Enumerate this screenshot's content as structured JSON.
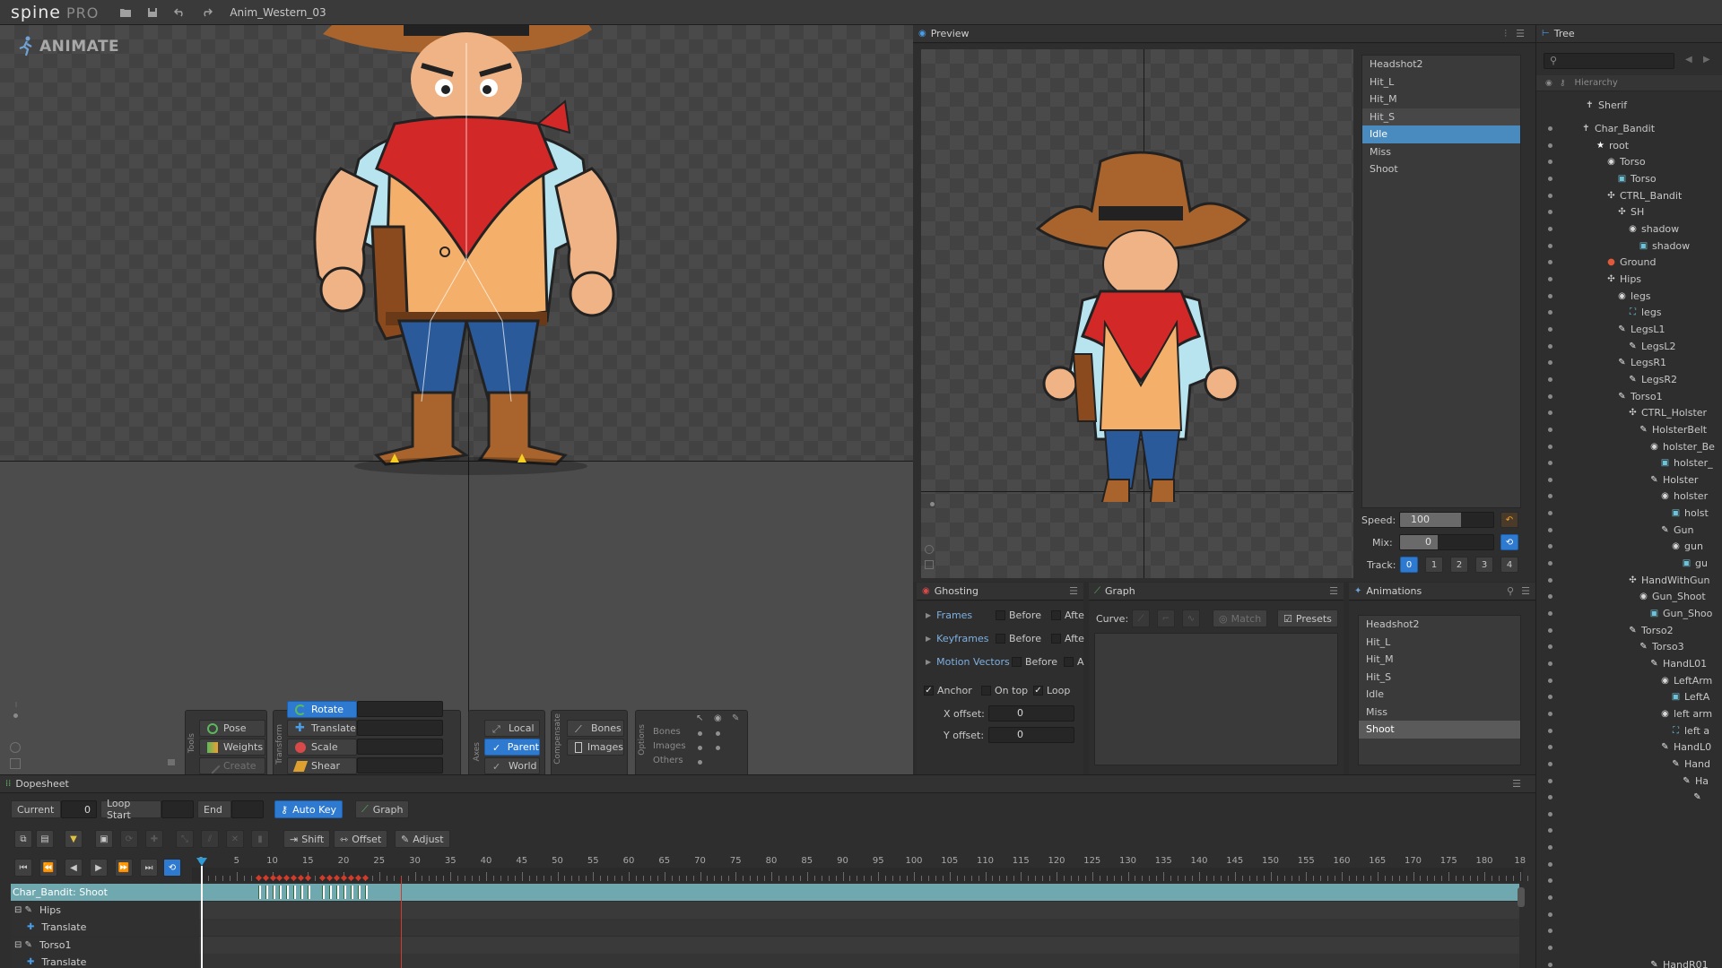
{
  "app": {
    "logo_main": "spine",
    "logo_pro": "PRO",
    "filename": "Anim_Western_03",
    "mode": "ANIMATE"
  },
  "tools": {
    "tools_label": "Tools",
    "transform_label": "Transform",
    "axes_label": "Axes",
    "compensate_label": "Compensate",
    "options_label": "Options",
    "pose": "Pose",
    "weights": "Weights",
    "create": "Create",
    "rotate": "Rotate",
    "translate": "Translate",
    "scale": "Scale",
    "shear": "Shear",
    "local": "Local",
    "parent": "Parent",
    "world": "World",
    "bones": "Bones",
    "images": "Images",
    "opt_bones": "Bones",
    "opt_images": "Images",
    "opt_others": "Others"
  },
  "preview": {
    "title": "Preview",
    "animations": [
      "Headshot2",
      "Hit_L",
      "Hit_M",
      "Hit_S",
      "Idle",
      "Miss",
      "Shoot"
    ],
    "selected": "Idle",
    "speed_label": "Speed:",
    "speed_value": "100",
    "speed_fraction": 0.65,
    "mix_label": "Mix:",
    "mix_value": "0",
    "mix_fraction": 0.4,
    "track_label": "Track:",
    "tracks": [
      "0",
      "1",
      "2",
      "3",
      "4"
    ],
    "active_track": "0"
  },
  "ghosting": {
    "title": "Ghosting",
    "frames": "Frames",
    "keyframes": "Keyframes",
    "motion_vectors": "Motion Vectors",
    "before": "Before",
    "after": "Afte",
    "after_short": "A",
    "anchor": "Anchor",
    "on_top": "On top",
    "loop": "Loop",
    "x_offset_label": "X offset:",
    "x_offset": "0",
    "y_offset_label": "Y offset:",
    "y_offset": "0"
  },
  "graph": {
    "title": "Graph",
    "curve_label": "Curve:",
    "match": "Match",
    "presets": "Presets"
  },
  "animations": {
    "title": "Animations",
    "items": [
      "Headshot2",
      "Hit_L",
      "Hit_M",
      "Hit_S",
      "Idle",
      "Miss",
      "Shoot"
    ],
    "selected": "Shoot"
  },
  "tree": {
    "title": "Tree",
    "hierarchy": "Hierarchy",
    "rows": [
      {
        "label": "Sherif",
        "indent": 0,
        "icon": "skeleton"
      },
      {
        "label": "Char_Bandit",
        "indent": 0,
        "icon": "skeleton"
      },
      {
        "label": "root",
        "indent": 1,
        "icon": "root"
      },
      {
        "label": "Torso",
        "indent": 2,
        "icon": "slot"
      },
      {
        "label": "Torso",
        "indent": 3,
        "icon": "image"
      },
      {
        "label": "CTRL_Bandit",
        "indent": 2,
        "icon": "bone"
      },
      {
        "label": "SH",
        "indent": 3,
        "icon": "bone"
      },
      {
        "label": "shadow",
        "indent": 4,
        "icon": "slot"
      },
      {
        "label": "shadow",
        "indent": 5,
        "icon": "image"
      },
      {
        "label": "Ground",
        "indent": 2,
        "icon": "ground"
      },
      {
        "label": "Hips",
        "indent": 2,
        "icon": "bone"
      },
      {
        "label": "legs",
        "indent": 3,
        "icon": "slot"
      },
      {
        "label": "legs",
        "indent": 4,
        "icon": "mesh"
      },
      {
        "label": "LegsL1",
        "indent": 3,
        "icon": "bone2"
      },
      {
        "label": "LegsL2",
        "indent": 4,
        "icon": "bone2"
      },
      {
        "label": "LegsR1",
        "indent": 3,
        "icon": "bone2"
      },
      {
        "label": "LegsR2",
        "indent": 4,
        "icon": "bone2"
      },
      {
        "label": "Torso1",
        "indent": 3,
        "icon": "bone2"
      },
      {
        "label": "CTRL_Holster",
        "indent": 4,
        "icon": "bone"
      },
      {
        "label": "HolsterBelt",
        "indent": 5,
        "icon": "bone2"
      },
      {
        "label": "holster_Be",
        "indent": 6,
        "icon": "slot"
      },
      {
        "label": "holster_",
        "indent": 7,
        "icon": "image"
      },
      {
        "label": "Holster",
        "indent": 6,
        "icon": "bone2"
      },
      {
        "label": "holster",
        "indent": 7,
        "icon": "slot"
      },
      {
        "label": "holst",
        "indent": 8,
        "icon": "image"
      },
      {
        "label": "Gun",
        "indent": 7,
        "icon": "bone2"
      },
      {
        "label": "gun",
        "indent": 8,
        "icon": "slot"
      },
      {
        "label": "gu",
        "indent": 9,
        "icon": "image"
      },
      {
        "label": "HandWithGun",
        "indent": 4,
        "icon": "bone"
      },
      {
        "label": "Gun_Shoot",
        "indent": 5,
        "icon": "slot"
      },
      {
        "label": "Gun_Shoo",
        "indent": 6,
        "icon": "image"
      },
      {
        "label": "Torso2",
        "indent": 4,
        "icon": "bone2"
      },
      {
        "label": "Torso3",
        "indent": 5,
        "icon": "bone2"
      },
      {
        "label": "HandL01",
        "indent": 6,
        "icon": "bone2"
      },
      {
        "label": "LeftArm",
        "indent": 7,
        "icon": "slot"
      },
      {
        "label": "LeftA",
        "indent": 8,
        "icon": "image"
      },
      {
        "label": "left arm",
        "indent": 7,
        "icon": "slot"
      },
      {
        "label": "left a",
        "indent": 8,
        "icon": "mesh"
      },
      {
        "label": "HandL0",
        "indent": 7,
        "icon": "bone2"
      },
      {
        "label": "Hand",
        "indent": 8,
        "icon": "bone2"
      },
      {
        "label": "Ha",
        "indent": 9,
        "icon": "bone2"
      },
      {
        "label": "",
        "indent": 10,
        "icon": "bone2"
      },
      {
        "label": "",
        "indent": 10,
        "icon": "none"
      },
      {
        "label": "",
        "indent": 10,
        "icon": "none"
      },
      {
        "label": "",
        "indent": 10,
        "icon": "none"
      },
      {
        "label": "",
        "indent": 10,
        "icon": "none"
      },
      {
        "label": "",
        "indent": 10,
        "icon": "none"
      },
      {
        "label": "",
        "indent": 10,
        "icon": "none"
      },
      {
        "label": "",
        "indent": 10,
        "icon": "none"
      },
      {
        "label": "",
        "indent": 10,
        "icon": "none"
      },
      {
        "label": "",
        "indent": 10,
        "icon": "none"
      },
      {
        "label": "HandR01",
        "indent": 6,
        "icon": "bone2"
      }
    ]
  },
  "dopesheet": {
    "title": "Dopesheet",
    "current_label": "Current",
    "current_value": "0",
    "loop_start_label": "Loop Start",
    "loop_start_value": "",
    "end_label": "End",
    "end_value": "",
    "auto_key": "Auto Key",
    "graph": "Graph",
    "shift": "Shift",
    "offset": "Offset",
    "adjust": "Adjust",
    "ticks": [
      "0",
      "5",
      "10",
      "15",
      "20",
      "25",
      "30",
      "35",
      "40",
      "45",
      "50",
      "55",
      "60",
      "65",
      "70",
      "75",
      "80",
      "85",
      "90",
      "95",
      "100",
      "105",
      "110",
      "115",
      "120",
      "125",
      "130",
      "135",
      "140",
      "145",
      "150",
      "155",
      "160",
      "165",
      "170",
      "175",
      "180",
      "18"
    ],
    "rows": [
      {
        "label": "Char_Bandit: Shoot",
        "type": "header"
      },
      {
        "label": "Hips",
        "type": "bone"
      },
      {
        "label": "Translate",
        "type": "prop"
      },
      {
        "label": "Torso1",
        "type": "bone"
      },
      {
        "label": "Translate",
        "type": "prop"
      }
    ],
    "keyframes": [
      8,
      9,
      10,
      11,
      12,
      13,
      14,
      15,
      17,
      18,
      19,
      20,
      21,
      22,
      23
    ],
    "loop_end_frame": 28
  },
  "colors": {
    "accent": "#2e7ad0",
    "panel": "#2e2e2e",
    "header_row": "#6fa8ae",
    "key_red": "#d23a2a",
    "key_green": "#5cb85c"
  }
}
